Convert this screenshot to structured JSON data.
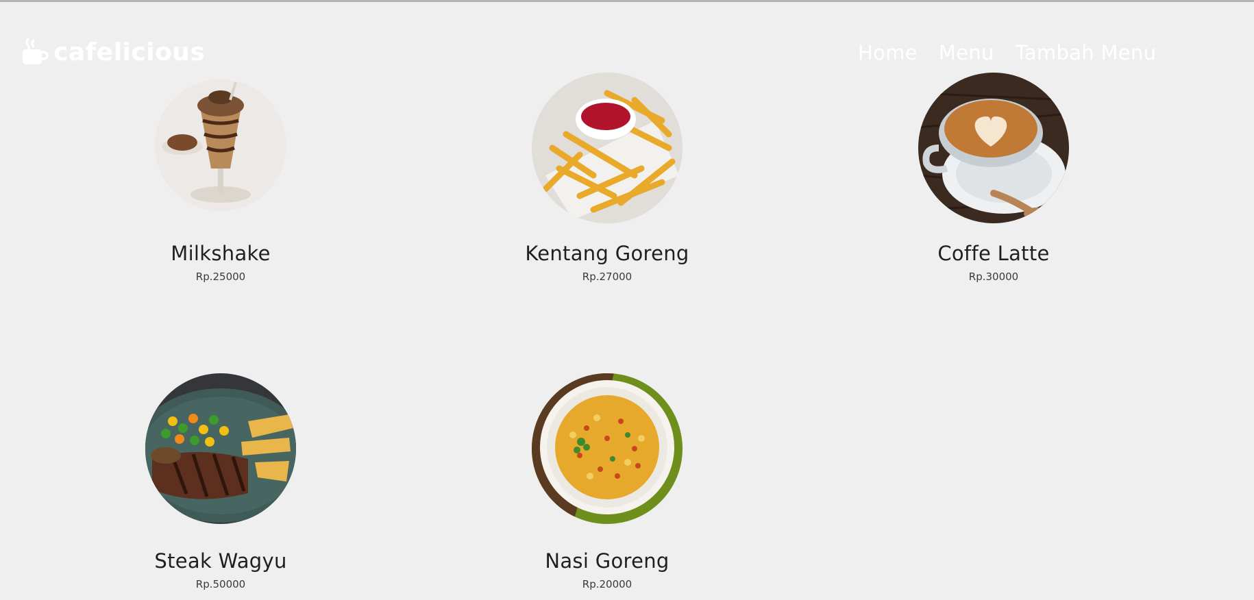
{
  "brand": {
    "name": "cafelicious",
    "icon": "coffee-cup-icon"
  },
  "nav": {
    "home": "Home",
    "menu": "Menu",
    "add_menu": "Tambah Menu"
  },
  "menu": {
    "items": [
      {
        "name": "Milkshake",
        "price": "Rp.25000",
        "image": "milkshake-photo"
      },
      {
        "name": "Kentang Goreng",
        "price": "Rp.27000",
        "image": "french-fries-photo"
      },
      {
        "name": "Coffe Latte",
        "price": "Rp.30000",
        "image": "coffee-latte-photo"
      },
      {
        "name": "Steak Wagyu",
        "price": "Rp.50000",
        "image": "wagyu-steak-photo"
      },
      {
        "name": "Nasi Goreng",
        "price": "Rp.20000",
        "image": "fried-rice-photo"
      }
    ]
  },
  "colors": {
    "background": "#efefef",
    "nav_text": "#ffffff",
    "title_text": "#1f1f1f"
  }
}
